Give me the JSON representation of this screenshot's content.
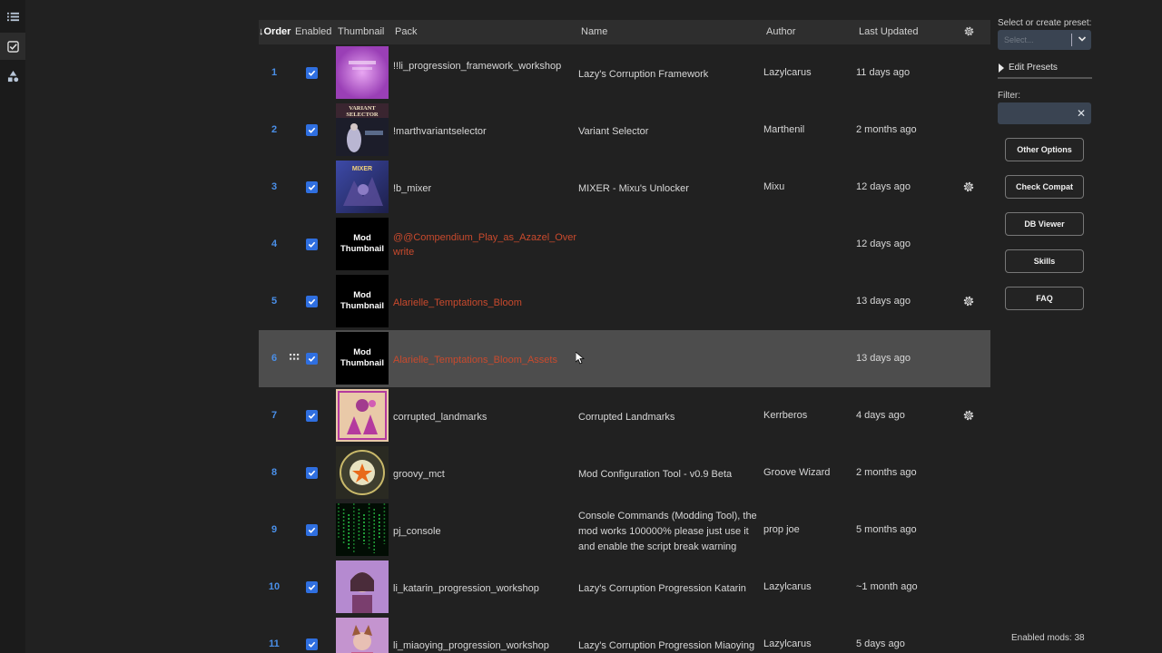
{
  "sidebar": {
    "items": [
      {
        "icon": "list-icon"
      },
      {
        "icon": "checklist-icon",
        "active": true
      },
      {
        "icon": "shapes-icon"
      }
    ]
  },
  "table": {
    "headers": {
      "order": "↓Order",
      "enabled": "Enabled",
      "thumbnail": "Thumbnail",
      "pack": "Pack",
      "name": "Name",
      "author": "Author",
      "last_updated": "Last Updated",
      "settings_icon": "gear-icon"
    },
    "rows": [
      {
        "order": "1",
        "pack": "!!li_progression_framework_workshop",
        "name": "Lazy's Corruption Framework",
        "author": "Lazylcarus",
        "updated": "11 days ago",
        "gear": false,
        "thumb": "purple"
      },
      {
        "order": "2",
        "pack": "!marthvariantselector",
        "name": "Variant Selector",
        "author": "Marthenil",
        "updated": "2 months ago",
        "gear": false,
        "thumb": "variant"
      },
      {
        "order": "3",
        "pack": "!b_mixer",
        "name": "MIXER - Mixu's Unlocker",
        "author": "Mixu",
        "updated": "12 days ago",
        "gear": true,
        "thumb": "mixer"
      },
      {
        "order": "4",
        "pack": "@@Compendium_Play_as_Azazel_Overwrite",
        "name": "",
        "author": "",
        "updated": "12 days ago",
        "gear": false,
        "thumb": "mod",
        "missing": true
      },
      {
        "order": "5",
        "pack": "Alarielle_Temptations_Bloom",
        "name": "",
        "author": "",
        "updated": "13 days ago",
        "gear": true,
        "thumb": "mod",
        "missing": true
      },
      {
        "order": "6",
        "pack": "Alarielle_Temptations_Bloom_Assets",
        "name": "",
        "author": "",
        "updated": "13 days ago",
        "gear": false,
        "thumb": "mod",
        "missing": true,
        "highlight": true
      },
      {
        "order": "7",
        "pack": "corrupted_landmarks",
        "name": "Corrupted Landmarks",
        "author": "Kerrberos",
        "updated": "4 days ago",
        "gear": true,
        "thumb": "landmarks"
      },
      {
        "order": "8",
        "pack": "groovy_mct",
        "name": "Mod Configuration Tool - v0.9 Beta",
        "author": "Groove Wizard",
        "updated": "2 months ago",
        "gear": false,
        "thumb": "groovy"
      },
      {
        "order": "9",
        "pack": "pj_console",
        "name": "Console Commands (Modding Tool), the mod works 100000% please just use it and enable the script break warning",
        "author": "prop joe",
        "updated": "5 months ago",
        "gear": false,
        "thumb": "matrix"
      },
      {
        "order": "10",
        "pack": "li_katarin_progression_workshop",
        "name": "Lazy's Corruption Progression Katarin",
        "author": "Lazylcarus",
        "updated": "~1 month ago",
        "gear": false,
        "thumb": "katarin"
      },
      {
        "order": "11",
        "pack": "li_miaoying_progression_workshop",
        "name": "Lazy's Corruption Progression Miaoying",
        "author": "Lazylcarus",
        "updated": "5 days ago",
        "gear": false,
        "thumb": "miaoying"
      }
    ],
    "mod_thumbnail_text": "Mod Thumbnail",
    "variant_thumb_text": "VARIANT SELECTOR",
    "mixer_thumb_text": "MIXER"
  },
  "right_panel": {
    "preset_label": "Select or create preset:",
    "preset_placeholder": "Select...",
    "edit_presets": "Edit Presets",
    "filter_label": "Filter:",
    "filter_value": "",
    "buttons": [
      "Other Options",
      "Check Compat",
      "DB Viewer",
      "Skills",
      "FAQ"
    ],
    "enabled_mods": "Enabled mods: 38"
  },
  "colors": {
    "accent": "#2f6fe0",
    "order_blue": "#4a8fe8",
    "missing_red": "#c94a2d",
    "background": "#212121"
  }
}
